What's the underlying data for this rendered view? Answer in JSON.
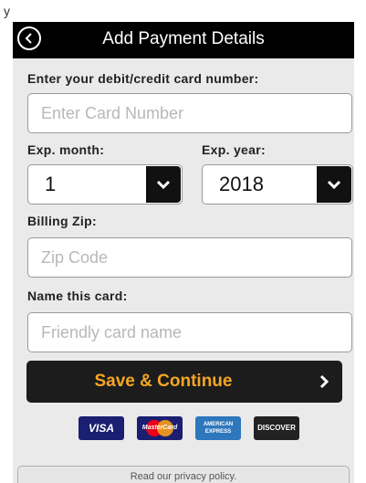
{
  "status_bar": {
    "text": "y"
  },
  "header": {
    "title": "Add Payment Details"
  },
  "form": {
    "card_number_label": "Enter your debit/credit card number:",
    "card_number_placeholder": "Enter Card Number",
    "card_number_value": "",
    "exp_month_label": "Exp. month:",
    "exp_month_value": "1",
    "exp_year_label": "Exp. year:",
    "exp_year_value": "2018",
    "zip_label": "Billing Zip:",
    "zip_placeholder": "Zip Code",
    "zip_value": "",
    "name_label": "Name this card:",
    "name_placeholder": "Friendly card name",
    "name_value": ""
  },
  "save_button": {
    "label": "Save & Continue",
    "chevron": "›"
  },
  "cards": {
    "visa": "VISA",
    "mastercard": "MasterCard",
    "amex_line1": "AMERICAN",
    "amex_line2": "EXPRESS",
    "discover": "DISCOVER"
  },
  "footer": {
    "privacy": "Read our privacy policy."
  },
  "colors": {
    "header_bg": "#000000",
    "form_bg": "#eaeaea",
    "accent": "#f5a623",
    "button_bg": "#1c1c1c"
  }
}
